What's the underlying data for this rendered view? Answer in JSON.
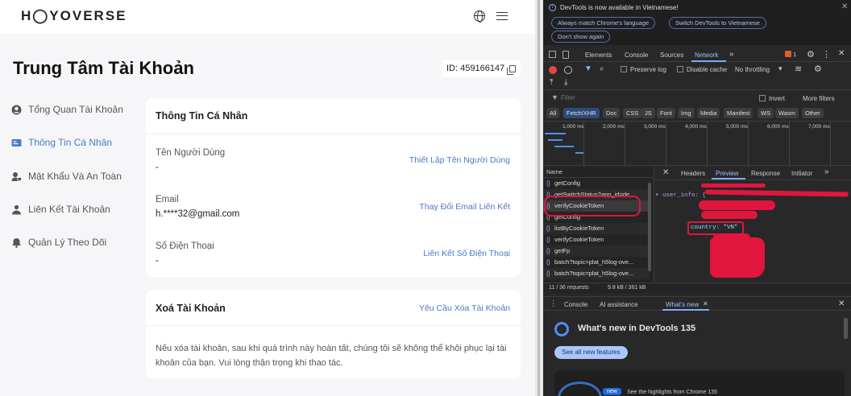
{
  "app": {
    "logo": "H◯YOVERSE",
    "page_title": "Trung Tâm Tài Khoản",
    "account_id": "ID: 459166147",
    "sidebar": [
      {
        "label": "Tổng Quan Tài Khoản",
        "icon": "user-circle-icon"
      },
      {
        "label": "Thông Tin Cá Nhân",
        "icon": "id-card-icon"
      },
      {
        "label": "Mật Khẩu Và An Toàn",
        "icon": "shield-lock-icon"
      },
      {
        "label": "Liên Kết Tài Khoản",
        "icon": "link-user-icon"
      },
      {
        "label": "Quản Lý Theo Dõi",
        "icon": "bell-icon"
      }
    ],
    "personal_info": {
      "title": "Thông Tin Cá Nhân",
      "fields": [
        {
          "label": "Tên Người Dùng",
          "value": "-",
          "action": "Thiết Lập Tên Người Dùng"
        },
        {
          "label": "Email",
          "value": "h.****32@gmail.com",
          "action": "Thay Đổi Email Liên Kết"
        },
        {
          "label": "Số Điện Thoại",
          "value": "-",
          "action": "Liên Kết Số Điện Thoại"
        }
      ]
    },
    "delete_account": {
      "title": "Xoá Tài Khoản",
      "action": "Yêu Cầu Xóa Tài Khoản",
      "description": "Nếu xóa tài khoản, sau khi quá trình này hoàn tất, chúng tôi sẽ không thể khôi phục lại tài khoản của bạn. Vui lòng thận trọng khi thao tác."
    }
  },
  "devtools": {
    "banner_text": "DevTools is now available in Vietnamese!",
    "banner_buttons": [
      "Always match Chrome's language",
      "Switch DevTools to Vietnamese",
      "Don't show again"
    ],
    "tabs": [
      "Elements",
      "Console",
      "Sources",
      "Network"
    ],
    "active_tab": "Network",
    "issues_count": "1",
    "toolbar": {
      "preserve_log": "Preserve log",
      "disable_cache": "Disable cache",
      "throttling": "No throttling"
    },
    "filter_placeholder": "Filter",
    "invert": "Invert",
    "more_filters": "More filters",
    "type_filters": [
      "All",
      "Fetch/XHR",
      "Doc",
      "CSS",
      "JS",
      "Font",
      "Img",
      "Media",
      "Manifest",
      "WS",
      "Wasm",
      "Other"
    ],
    "active_type": "Fetch/XHR",
    "timeline_ticks": [
      "1,000 ms",
      "2,000 ms",
      "3,000 ms",
      "4,000 ms",
      "5,000 ms",
      "6,000 ms",
      "7,000 ms"
    ],
    "name_header": "Name",
    "requests": [
      "getConfig",
      "getSwitchStatus?app_id=de...",
      "verifyCookieToken",
      "getConfig",
      "listByCookieToken",
      "verifyCookieToken",
      "getFp",
      "batch?topic=plat_h5log-ove...",
      "batch?topic=plat_h5log-ove..."
    ],
    "detail_tabs": [
      "Headers",
      "Preview",
      "Response",
      "Initiator"
    ],
    "active_detail_tab": "Preview",
    "preview_lines": [
      "user_info: {",
      "country: \"VN\""
    ],
    "status_bar": "11 / 36 requests",
    "transfer": "9.8 kB / 361 kB",
    "drawer_tabs": [
      "Console",
      "AI assistance",
      "What's new"
    ],
    "whats_new_title": "What's new in DevTools 135",
    "see_all": "See all new features",
    "highlights_badge": "new",
    "highlights_text": "See the highlights from Chrome 135"
  },
  "colors": {
    "accent": "#4a79c8",
    "devtools_bg": "#282828",
    "annotation_red": "#e0163d"
  }
}
